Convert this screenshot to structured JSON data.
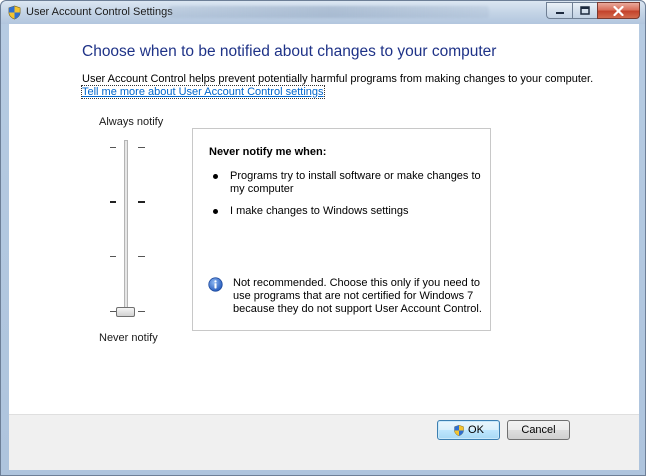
{
  "window": {
    "title": "User Account Control Settings"
  },
  "main": {
    "heading": "Choose when to be notified about changes to your computer",
    "description": "User Account Control helps prevent potentially harmful programs from making changes to your computer.",
    "learn_more_link": "Tell me more about User Account Control settings"
  },
  "slider": {
    "top_label": "Always notify",
    "bottom_label": "Never notify",
    "levels": 4,
    "selected_level": 1
  },
  "panel": {
    "title": "Never notify me when:",
    "bullets": [
      "Programs try to install software or make changes to my computer",
      "I make changes to Windows settings"
    ],
    "note": "Not recommended. Choose this only if you need to use programs that are not certified for Windows 7 because they do not support User Account Control."
  },
  "buttons": {
    "ok_label": "OK",
    "cancel_label": "Cancel"
  },
  "icons": {
    "title": "uac-shield-icon",
    "info": "info-icon",
    "ok_button": "uac-shield-icon"
  },
  "colors": {
    "heading": "#1e3287",
    "link": "#0066cc",
    "info_icon": "#2a63c7",
    "close_button": "#c4432c"
  }
}
